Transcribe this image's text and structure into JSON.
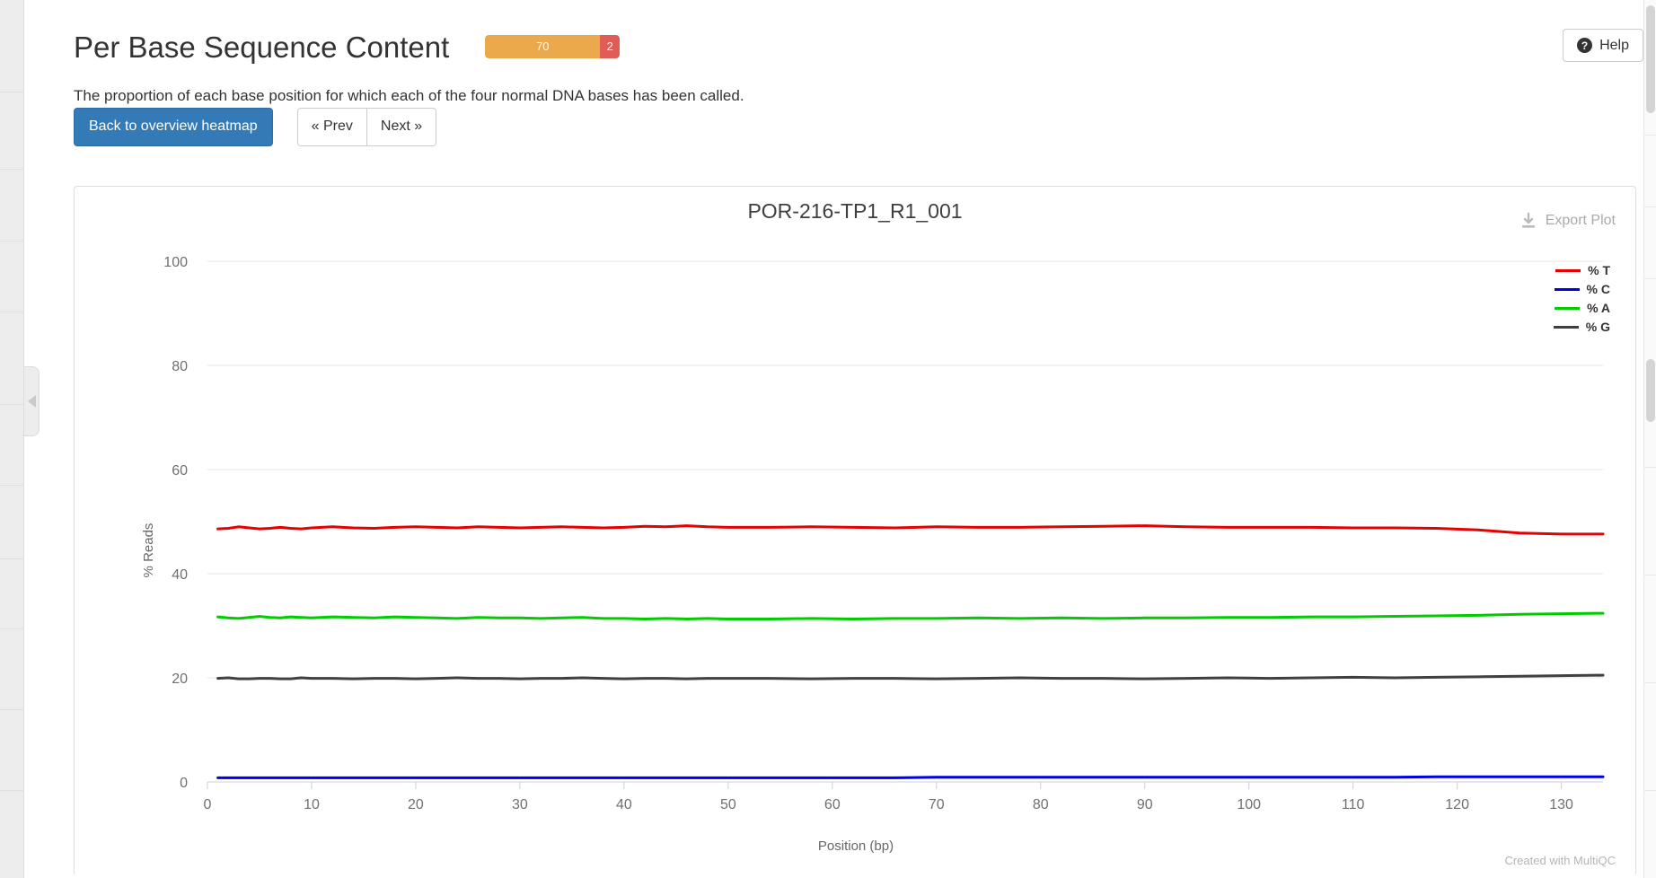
{
  "sidebar": {
    "toggle_icon": "chevron-left-icon"
  },
  "header": {
    "title": "Per Base Sequence Content",
    "description": "The proportion of each base position for which each of the four normal DNA bases has been called.",
    "status_badge": {
      "pass_value": "70",
      "fail_value": "2",
      "pass_color": "#eba94c",
      "fail_color": "#e05c57"
    },
    "help_label": "Help",
    "help_icon": "question-circle-icon"
  },
  "toolbar": {
    "back_label": "Back to overview heatmap",
    "prev_label": "« Prev",
    "next_label": "Next »"
  },
  "plot": {
    "export_label": "Export Plot",
    "export_icon": "download-icon",
    "footer_credit": "Created with MultiQC"
  },
  "chart_data": {
    "type": "line",
    "title": "POR-216-TP1_R1_001",
    "xlabel": "Position (bp)",
    "ylabel": "% Reads",
    "xlim": [
      0,
      134
    ],
    "ylim": [
      0,
      100
    ],
    "xticks": [
      0,
      10,
      20,
      30,
      40,
      50,
      60,
      70,
      80,
      90,
      100,
      110,
      120,
      130
    ],
    "yticks": [
      0,
      20,
      40,
      60,
      80,
      100
    ],
    "grid": true,
    "legend_position": "top-right",
    "x": [
      1,
      2,
      3,
      4,
      5,
      6,
      7,
      8,
      9,
      10,
      12,
      14,
      16,
      18,
      20,
      22,
      24,
      26,
      28,
      30,
      32,
      34,
      36,
      38,
      40,
      42,
      44,
      46,
      48,
      50,
      54,
      58,
      62,
      66,
      70,
      74,
      78,
      82,
      86,
      90,
      94,
      98,
      102,
      106,
      110,
      114,
      118,
      122,
      126,
      130,
      134
    ],
    "series": [
      {
        "name": "% T",
        "color": "#e60000",
        "values": [
          48.6,
          48.7,
          49.0,
          48.8,
          48.6,
          48.7,
          48.9,
          48.7,
          48.6,
          48.8,
          49.0,
          48.8,
          48.7,
          48.9,
          49.0,
          48.9,
          48.8,
          49.0,
          48.9,
          48.8,
          48.9,
          49.0,
          48.9,
          48.8,
          48.9,
          49.1,
          49.0,
          49.2,
          49.0,
          48.9,
          48.9,
          49.0,
          48.9,
          48.8,
          49.0,
          48.9,
          48.9,
          49.0,
          49.1,
          49.2,
          49.0,
          48.9,
          48.9,
          48.9,
          48.8,
          48.8,
          48.7,
          48.4,
          47.8,
          47.6,
          47.6
        ]
      },
      {
        "name": "% C",
        "color": "#0000e6",
        "values": [
          0.8,
          0.8,
          0.8,
          0.8,
          0.8,
          0.8,
          0.8,
          0.8,
          0.8,
          0.8,
          0.8,
          0.8,
          0.8,
          0.8,
          0.8,
          0.8,
          0.8,
          0.8,
          0.8,
          0.8,
          0.8,
          0.8,
          0.8,
          0.8,
          0.8,
          0.8,
          0.8,
          0.8,
          0.8,
          0.8,
          0.8,
          0.8,
          0.8,
          0.8,
          0.9,
          0.9,
          0.9,
          0.9,
          0.9,
          0.9,
          0.9,
          0.9,
          0.9,
          0.9,
          0.9,
          0.9,
          1.0,
          1.0,
          1.0,
          1.0,
          1.0
        ]
      },
      {
        "name": "% A",
        "color": "#00cc00",
        "values": [
          31.7,
          31.5,
          31.4,
          31.6,
          31.8,
          31.6,
          31.5,
          31.7,
          31.6,
          31.5,
          31.7,
          31.6,
          31.5,
          31.7,
          31.6,
          31.5,
          31.4,
          31.6,
          31.5,
          31.5,
          31.4,
          31.5,
          31.6,
          31.4,
          31.4,
          31.3,
          31.4,
          31.3,
          31.4,
          31.3,
          31.3,
          31.4,
          31.3,
          31.4,
          31.4,
          31.5,
          31.4,
          31.5,
          31.4,
          31.5,
          31.5,
          31.6,
          31.6,
          31.7,
          31.7,
          31.8,
          31.9,
          32.0,
          32.2,
          32.3,
          32.4
        ]
      },
      {
        "name": "% G",
        "color": "#404040",
        "values": [
          19.9,
          20.0,
          19.8,
          19.8,
          19.9,
          19.9,
          19.8,
          19.8,
          20.0,
          19.9,
          19.9,
          19.8,
          19.9,
          19.9,
          19.8,
          19.9,
          20.0,
          19.9,
          19.9,
          19.8,
          19.9,
          19.9,
          20.0,
          19.9,
          19.8,
          19.9,
          19.9,
          19.8,
          19.9,
          19.9,
          19.9,
          19.8,
          19.9,
          19.9,
          19.8,
          19.9,
          20.0,
          19.9,
          19.9,
          19.8,
          19.9,
          20.0,
          19.9,
          20.0,
          20.1,
          20.0,
          20.1,
          20.2,
          20.3,
          20.4,
          20.5
        ]
      }
    ]
  }
}
